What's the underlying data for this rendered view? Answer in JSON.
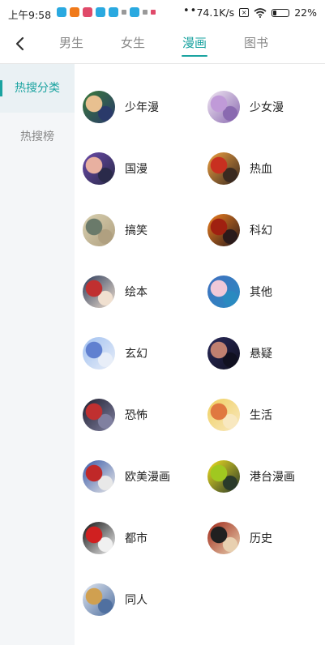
{
  "status_bar": {
    "time": "上午9:58",
    "speed": "74.1K/s",
    "battery": "22%",
    "app_icon_colors": [
      "#2aa9e0",
      "#f07a1a",
      "#e04a6a",
      "#2aa9e0",
      "#2aa9e0",
      "#999999",
      "#2aa9e0",
      "#999999",
      "#e04a6a"
    ]
  },
  "nav": {
    "tabs": [
      {
        "label": "男生",
        "active": false
      },
      {
        "label": "女生",
        "active": false
      },
      {
        "label": "漫画",
        "active": true
      },
      {
        "label": "图书",
        "active": false
      }
    ]
  },
  "sidebar": {
    "items": [
      {
        "label": "热搜分类",
        "active": true
      },
      {
        "label": "热搜榜",
        "active": false
      }
    ]
  },
  "categories": [
    {
      "label": "少年漫",
      "colors": [
        "#3a7a3a",
        "#e8c090",
        "#2a3a6a"
      ]
    },
    {
      "label": "少女漫",
      "colors": [
        "#f0e6f2",
        "#c09ad8",
        "#8a6ab0"
      ]
    },
    {
      "label": "国漫",
      "colors": [
        "#6a4aa8",
        "#e8b0a0",
        "#2a2a4a"
      ]
    },
    {
      "label": "热血",
      "colors": [
        "#f0a040",
        "#c83020",
        "#3a2a20"
      ]
    },
    {
      "label": "搞笑",
      "colors": [
        "#d8d0b0",
        "#6a7a6a",
        "#b0a080"
      ]
    },
    {
      "label": "科幻",
      "colors": [
        "#f08020",
        "#a02010",
        "#2a1a1a"
      ]
    },
    {
      "label": "绘本",
      "colors": [
        "#2a3a5a",
        "#c03030",
        "#f0e0d0"
      ]
    },
    {
      "label": "其他",
      "colors": [
        "#4070c0",
        "#f0c8d8",
        "#2a8ac0"
      ]
    },
    {
      "label": "玄幻",
      "colors": [
        "#a0c0f0",
        "#6080d0",
        "#e8eef8"
      ]
    },
    {
      "label": "悬疑",
      "colors": [
        "#2a2a5a",
        "#c08070",
        "#101020"
      ]
    },
    {
      "label": "恐怖",
      "colors": [
        "#202030",
        "#c03030",
        "#8080a0"
      ]
    },
    {
      "label": "生活",
      "colors": [
        "#f0d060",
        "#e07840",
        "#f8e8c0"
      ]
    },
    {
      "label": "欧美漫画",
      "colors": [
        "#3a5aa8",
        "#c02828",
        "#e8e8e8"
      ]
    },
    {
      "label": "港台漫画",
      "colors": [
        "#f0e020",
        "#a0c820",
        "#2a3a2a"
      ]
    },
    {
      "label": "都市",
      "colors": [
        "#101010",
        "#d02020",
        "#f0f0f0"
      ]
    },
    {
      "label": "历史",
      "colors": [
        "#a02818",
        "#202020",
        "#e8d0b0"
      ]
    },
    {
      "label": "同人",
      "colors": [
        "#e0e6f0",
        "#d0a050",
        "#5070a0"
      ]
    }
  ]
}
